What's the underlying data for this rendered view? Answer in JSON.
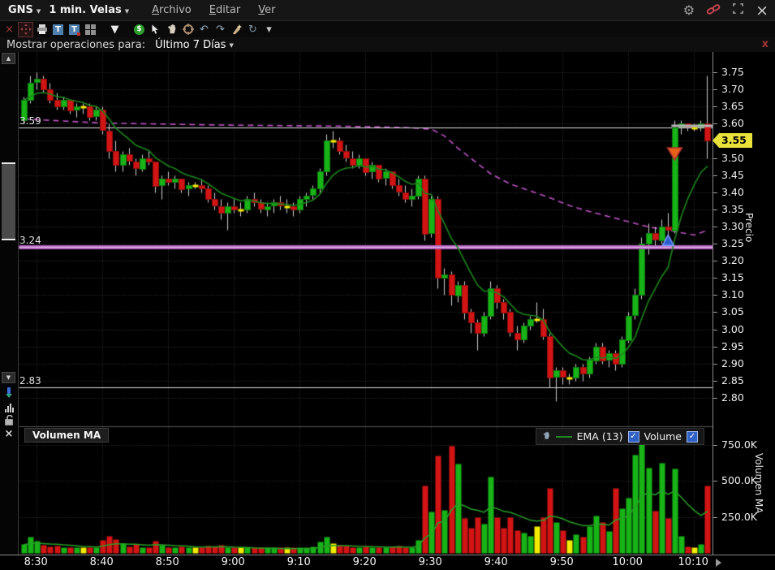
{
  "title_bar": {
    "symbol": "GNS",
    "timeframe": "1 min. Velas",
    "menus": [
      "Archivo",
      "Editar",
      "Ver"
    ],
    "window_icons": [
      "settings-gear-icon",
      "link-icon",
      "maximize-icon",
      "close-icon"
    ]
  },
  "toolbar": {
    "icons": [
      {
        "name": "remove-study",
        "glyph": "×",
        "color": "#a33636"
      },
      {
        "name": "move-tool",
        "selected": true
      },
      {
        "name": "print"
      },
      {
        "name": "text-note"
      },
      {
        "name": "text-note-alert"
      },
      {
        "name": "layout-grid"
      },
      {
        "name": "spacer"
      },
      {
        "name": "draw-dropdown",
        "glyph": "▼",
        "color": "#e8e8e8"
      },
      {
        "name": "spacer"
      },
      {
        "name": "price-alert-dollar"
      },
      {
        "name": "pointer-tool"
      },
      {
        "name": "pan-hand-tool"
      },
      {
        "name": "crosshair-target"
      },
      {
        "name": "undo",
        "glyph": "↶",
        "color": "#93a7b8"
      },
      {
        "name": "redo",
        "glyph": "↷",
        "color": "#93a7b8"
      },
      {
        "name": "paintbrush"
      },
      {
        "name": "refresh",
        "glyph": "↻",
        "color": "#7d93a6"
      },
      {
        "name": "refresh-dropdown",
        "glyph": "▾",
        "color": "#c8c8c8"
      }
    ]
  },
  "filter_bar": {
    "label": "Mostrar operaciones para:",
    "value": "Último 7 Días",
    "close_glyph": "x"
  },
  "left_rail": [
    "scroll-up",
    "scroll-thumb",
    "scroll-down",
    "pointer-pin",
    "volume-histogram",
    "lock",
    "close-pane"
  ],
  "price_pane": {
    "axis_title": "Precio",
    "tick_labels": [
      "3.75",
      "3.70",
      "3.65",
      "3.60",
      "3.55",
      "3.50",
      "3.45",
      "3.40",
      "3.35",
      "3.30",
      "3.25",
      "3.20",
      "3.15",
      "3.10",
      "3.05",
      "3.00",
      "2.95",
      "2.90",
      "2.85",
      "2.80"
    ],
    "current_price_label": "3.55"
  },
  "volume_pane": {
    "panel_label": "Volumen MA",
    "legend": {
      "ema_label": "EMA (13)",
      "ema_checked": true,
      "volume_label": "Volume",
      "volume_checked": true,
      "check_glyph": "✓"
    },
    "tick_labels": [
      "750.0K",
      "500.0K",
      "250.0K"
    ],
    "axis_title": "Volumen MA"
  },
  "time_axis": {
    "labels": [
      "8:30",
      "8:40",
      "8:50",
      "9:00",
      "9:10",
      "9:20",
      "9:30",
      "9:40",
      "9:50",
      "10:00",
      "10:10"
    ],
    "first_label_index": 2,
    "label_step": 10
  },
  "chart_data": {
    "type": "candlestick+volume",
    "symbol": "GNS",
    "interval": "1 minute",
    "title": "GNS 1 min. Velas",
    "price_axis": {
      "min": 2.8,
      "max": 3.75,
      "tick_step": 0.05,
      "label": "Precio"
    },
    "volume_axis": {
      "min": 0,
      "max": 800,
      "tick_step": 250,
      "unit": "K",
      "label": "Volumen MA"
    },
    "grid": true,
    "colors": {
      "up": "#17b317",
      "up_border": "#0c7a0c",
      "down": "#d31414",
      "down_border": "#8e0e0e",
      "doji": "#f4ec00",
      "wick": "#cfcfcf",
      "price_ema": "#1c871c",
      "slow_ma": "#bf52c8",
      "volume_ema": "#28a028",
      "hline_white": "#e0e0e0",
      "hline_pink": "#b55cc0",
      "hline_pink_core": "#e3bfe8",
      "high_segment": "#b5b5b5",
      "grid": "#3b3b3b",
      "tag_bg": "#e8e23a"
    },
    "hlines": [
      {
        "label": "3.59",
        "price": 3.59,
        "style": "thin-white"
      },
      {
        "label": "3.24",
        "price": 3.24,
        "style": "thick-pink"
      },
      {
        "label": "2.83",
        "price": 2.83,
        "style": "thin-white"
      }
    ],
    "current_price": 3.55,
    "high_segment": {
      "start_index": 99,
      "price": 3.595
    },
    "markers": [
      {
        "index": 98,
        "price": 3.26,
        "type": "buy",
        "shape": "triangle-up",
        "fill": "#2e5bcc",
        "stroke": "#7d9bff"
      },
      {
        "index": 99,
        "price": 3.5,
        "type": "sell",
        "shape": "triangle-down",
        "fill": "#e8611a",
        "stroke": "#b03030"
      }
    ],
    "price_ema_period": 9,
    "volume_ema_period": 13,
    "volume_unit": "K",
    "candles_format": [
      "open",
      "high",
      "low",
      "close",
      "volume_K"
    ],
    "candles": [
      [
        3.61,
        3.68,
        3.6,
        3.67,
        60
      ],
      [
        3.67,
        3.74,
        3.66,
        3.72,
        115
      ],
      [
        3.72,
        3.75,
        3.7,
        3.73,
        85
      ],
      [
        3.73,
        3.74,
        3.69,
        3.7,
        55
      ],
      [
        3.7,
        3.72,
        3.66,
        3.67,
        45
      ],
      [
        3.67,
        3.69,
        3.64,
        3.65,
        50
      ],
      [
        3.65,
        3.68,
        3.64,
        3.67,
        35
      ],
      [
        3.67,
        3.67,
        3.63,
        3.64,
        40
      ],
      [
        3.64,
        3.66,
        3.62,
        3.65,
        30
      ],
      [
        3.65,
        3.66,
        3.63,
        3.65,
        25
      ],
      [
        3.65,
        3.66,
        3.61,
        3.62,
        35
      ],
      [
        3.62,
        3.65,
        3.61,
        3.64,
        30
      ],
      [
        3.64,
        3.65,
        3.57,
        3.58,
        90
      ],
      [
        3.58,
        3.6,
        3.5,
        3.52,
        120
      ],
      [
        3.52,
        3.55,
        3.46,
        3.48,
        95
      ],
      [
        3.48,
        3.52,
        3.46,
        3.51,
        70
      ],
      [
        3.51,
        3.53,
        3.48,
        3.49,
        45
      ],
      [
        3.49,
        3.5,
        3.45,
        3.47,
        60
      ],
      [
        3.47,
        3.51,
        3.46,
        3.5,
        40
      ],
      [
        3.5,
        3.52,
        3.48,
        3.49,
        35
      ],
      [
        3.49,
        3.49,
        3.4,
        3.42,
        85
      ],
      [
        3.42,
        3.45,
        3.38,
        3.44,
        55
      ],
      [
        3.44,
        3.46,
        3.42,
        3.43,
        40
      ],
      [
        3.43,
        3.45,
        3.41,
        3.44,
        35
      ],
      [
        3.44,
        3.44,
        3.4,
        3.41,
        45
      ],
      [
        3.41,
        3.43,
        3.39,
        3.42,
        30
      ],
      [
        3.42,
        3.43,
        3.41,
        3.42,
        25
      ],
      [
        3.42,
        3.44,
        3.4,
        3.41,
        30
      ],
      [
        3.41,
        3.42,
        3.37,
        3.38,
        50
      ],
      [
        3.38,
        3.4,
        3.35,
        3.36,
        45
      ],
      [
        3.36,
        3.38,
        3.32,
        3.34,
        55
      ],
      [
        3.34,
        3.37,
        3.29,
        3.36,
        40
      ],
      [
        3.36,
        3.38,
        3.34,
        3.35,
        30
      ],
      [
        3.35,
        3.37,
        3.33,
        3.35,
        35
      ],
      [
        3.35,
        3.39,
        3.34,
        3.38,
        30
      ],
      [
        3.38,
        3.4,
        3.36,
        3.37,
        25
      ],
      [
        3.37,
        3.38,
        3.34,
        3.35,
        30
      ],
      [
        3.35,
        3.37,
        3.33,
        3.36,
        28
      ],
      [
        3.36,
        3.38,
        3.34,
        3.37,
        30
      ],
      [
        3.37,
        3.39,
        3.35,
        3.36,
        25
      ],
      [
        3.36,
        3.38,
        3.34,
        3.36,
        28
      ],
      [
        3.36,
        3.37,
        3.33,
        3.35,
        30
      ],
      [
        3.35,
        3.39,
        3.34,
        3.38,
        35
      ],
      [
        3.38,
        3.4,
        3.36,
        3.39,
        30
      ],
      [
        3.39,
        3.42,
        3.38,
        3.41,
        45
      ],
      [
        3.41,
        3.47,
        3.4,
        3.46,
        80
      ],
      [
        3.46,
        3.57,
        3.45,
        3.55,
        110
      ],
      [
        3.55,
        3.58,
        3.53,
        3.55,
        70
      ],
      [
        3.55,
        3.56,
        3.51,
        3.52,
        55
      ],
      [
        3.52,
        3.54,
        3.49,
        3.5,
        50
      ],
      [
        3.5,
        3.52,
        3.47,
        3.48,
        40
      ],
      [
        3.48,
        3.51,
        3.47,
        3.5,
        35
      ],
      [
        3.5,
        3.5,
        3.45,
        3.46,
        45
      ],
      [
        3.46,
        3.49,
        3.44,
        3.48,
        30
      ],
      [
        3.48,
        3.48,
        3.43,
        3.44,
        40
      ],
      [
        3.44,
        3.47,
        3.42,
        3.46,
        35
      ],
      [
        3.46,
        3.46,
        3.41,
        3.42,
        45
      ],
      [
        3.42,
        3.44,
        3.39,
        3.4,
        50
      ],
      [
        3.4,
        3.42,
        3.37,
        3.38,
        40
      ],
      [
        3.38,
        3.41,
        3.36,
        3.39,
        35
      ],
      [
        3.39,
        3.45,
        3.38,
        3.44,
        90
      ],
      [
        3.44,
        3.45,
        3.26,
        3.28,
        465
      ],
      [
        3.28,
        3.39,
        3.27,
        3.38,
        285
      ],
      [
        3.38,
        3.39,
        3.12,
        3.15,
        675
      ],
      [
        3.15,
        3.18,
        3.1,
        3.16,
        300
      ],
      [
        3.16,
        3.17,
        3.07,
        3.1,
        740
      ],
      [
        3.1,
        3.14,
        3.08,
        3.13,
        620
      ],
      [
        3.13,
        3.14,
        3.03,
        3.05,
        240
      ],
      [
        3.05,
        3.06,
        2.99,
        3.02,
        175
      ],
      [
        3.02,
        3.03,
        2.94,
        2.99,
        245
      ],
      [
        2.99,
        3.05,
        2.98,
        3.04,
        205
      ],
      [
        3.04,
        3.14,
        3.03,
        3.12,
        530
      ],
      [
        3.12,
        3.13,
        3.06,
        3.08,
        250
      ],
      [
        3.08,
        3.09,
        3.03,
        3.05,
        175
      ],
      [
        3.05,
        3.06,
        2.98,
        2.99,
        245
      ],
      [
        2.99,
        3.01,
        2.94,
        2.97,
        160
      ],
      [
        2.97,
        3.02,
        2.96,
        3.01,
        140
      ],
      [
        3.01,
        3.04,
        3.0,
        3.03,
        120
      ],
      [
        3.03,
        3.08,
        3.02,
        3.03,
        185
      ],
      [
        3.03,
        3.06,
        2.97,
        2.98,
        250
      ],
      [
        2.98,
        2.99,
        2.83,
        2.86,
        450
      ],
      [
        2.86,
        2.89,
        2.79,
        2.88,
        215
      ],
      [
        2.88,
        2.89,
        2.84,
        2.86,
        160
      ],
      [
        2.86,
        2.87,
        2.84,
        2.86,
        90
      ],
      [
        2.86,
        2.9,
        2.85,
        2.89,
        130
      ],
      [
        2.89,
        2.9,
        2.85,
        2.87,
        110
      ],
      [
        2.87,
        2.92,
        2.86,
        2.91,
        185
      ],
      [
        2.91,
        2.96,
        2.9,
        2.95,
        260
      ],
      [
        2.95,
        2.96,
        2.9,
        2.91,
        215
      ],
      [
        2.91,
        2.94,
        2.89,
        2.93,
        150
      ],
      [
        2.93,
        2.94,
        2.88,
        2.9,
        450
      ],
      [
        2.9,
        2.98,
        2.89,
        2.97,
        310
      ],
      [
        2.97,
        3.05,
        2.96,
        3.04,
        380
      ],
      [
        3.04,
        3.12,
        3.03,
        3.1,
        680
      ],
      [
        3.1,
        3.27,
        3.09,
        3.25,
        835
      ],
      [
        3.25,
        3.31,
        3.22,
        3.28,
        590
      ],
      [
        3.28,
        3.3,
        3.24,
        3.26,
        290
      ],
      [
        3.26,
        3.32,
        3.25,
        3.3,
        625
      ],
      [
        3.3,
        3.34,
        3.25,
        3.29,
        240
      ],
      [
        3.29,
        3.61,
        3.28,
        3.59,
        585
      ],
      [
        3.59,
        3.61,
        3.57,
        3.6,
        120
      ],
      [
        3.6,
        3.6,
        3.58,
        3.59,
        45
      ],
      [
        3.59,
        3.6,
        3.58,
        3.59,
        35
      ],
      [
        3.59,
        3.61,
        3.58,
        3.6,
        60
      ],
      [
        3.6,
        3.74,
        3.5,
        3.55,
        465
      ]
    ],
    "slow_ma_points": [
      [
        0,
        3.615
      ],
      [
        12,
        3.603
      ],
      [
        30,
        3.597
      ],
      [
        48,
        3.594
      ],
      [
        58,
        3.59
      ],
      [
        62,
        3.585
      ],
      [
        64,
        3.565
      ],
      [
        66,
        3.53
      ],
      [
        68,
        3.5
      ],
      [
        71,
        3.455
      ],
      [
        74,
        3.425
      ],
      [
        77,
        3.405
      ],
      [
        80,
        3.385
      ],
      [
        83,
        3.362
      ],
      [
        86,
        3.345
      ],
      [
        89,
        3.33
      ],
      [
        92,
        3.315
      ],
      [
        95,
        3.3
      ],
      [
        98,
        3.29
      ],
      [
        100,
        3.283
      ],
      [
        102,
        3.276
      ],
      [
        104,
        3.29
      ]
    ]
  }
}
